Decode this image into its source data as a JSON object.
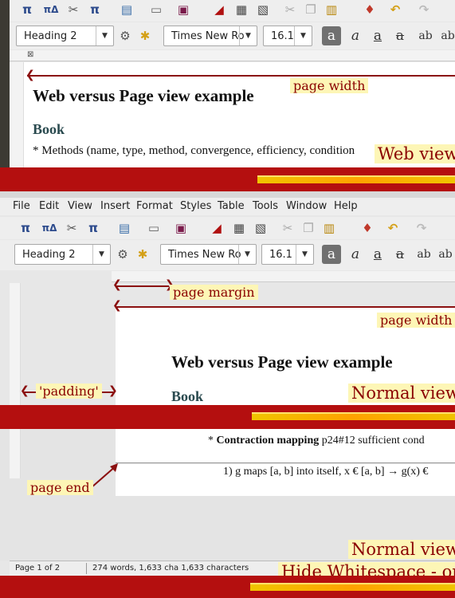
{
  "panel1": {
    "style": "Heading 2",
    "font": "Times New Ro",
    "size": "16.1",
    "heading": "Web versus Page view example",
    "subheading": "Book",
    "body": "* Methods (name, type, method, convergence, efficiency, condition",
    "label_page_width": "page width",
    "caption": "Web view"
  },
  "panel2": {
    "menu": [
      "File",
      "Edit",
      "View",
      "Insert",
      "Format",
      "Styles",
      "Table",
      "Tools",
      "Window",
      "Help"
    ],
    "style": "Heading 2",
    "font": "Times New Ro",
    "size": "16.1",
    "label_page_margin": "page margin",
    "label_page_width": "page width",
    "heading": "Web versus Page view example",
    "subheading": "Book",
    "label_padding": "'padding'",
    "caption": "Normal view"
  },
  "panel3": {
    "line1_prefix": "* ",
    "line1_bold": "Contraction mapping",
    "line1_rest": " p24#12 sufficient cond",
    "line2": "1) g maps [a, b] into itself, x € [a, b] → g(x) €",
    "label_page_end": "page end",
    "caption_normal": "Normal view",
    "caption_hide": "Hide Whitespace - on",
    "status_page": "Page 1 of 2",
    "status_words": "274 words, 1,633 cha 1,633 characters"
  },
  "toolbar_icons": [
    "math-pi-icon",
    "math-sigma-icon",
    "tools-icon",
    "math-formula-icon",
    "new-document-icon",
    "open-folder-icon",
    "save-icon",
    "export-pdf-icon",
    "print-icon",
    "print-preview-icon",
    "cut-icon",
    "copy-icon",
    "paste-icon",
    "clone-formatting-icon",
    "undo-icon",
    "redo-icon"
  ],
  "format_buttons": [
    "a",
    "a",
    "a",
    "a",
    "ab",
    "ab"
  ],
  "colors": {
    "band": "#b40f0f",
    "caption_bg": "#fdf6b6",
    "caption_text": "#8a0000",
    "arrow": "#8b1010"
  }
}
